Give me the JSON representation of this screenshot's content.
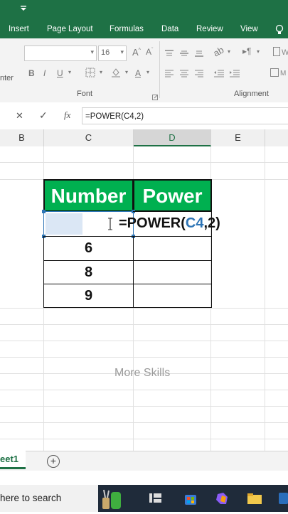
{
  "menu": [
    "Insert",
    "Page Layout",
    "Formulas",
    "Data",
    "Review",
    "View"
  ],
  "ribbon": {
    "font_size": "16",
    "font_group_label": "Font",
    "alignment_group_label": "Alignment",
    "left_cut_label": "nter"
  },
  "formula_bar": {
    "cancel": "✕",
    "enter": "✓",
    "fx": "fx",
    "value": "=POWER(C4,2)"
  },
  "columns": [
    "B",
    "C",
    "D",
    "E"
  ],
  "table": {
    "header_number": "Number",
    "header_power": "Power",
    "edit_formula_prefix": "=POWER(",
    "edit_formula_ref": "C4",
    "edit_formula_suffix": ",2)",
    "numbers": [
      "6",
      "8",
      "9"
    ]
  },
  "watermark": "More Skills",
  "sheet_tab": "eet1",
  "add_sheet": "+",
  "taskbar": {
    "search_text": "here to search"
  },
  "colors": {
    "excel_green": "#1e7145",
    "header_fill": "#00b050",
    "ref_blue": "#2e75b6"
  }
}
